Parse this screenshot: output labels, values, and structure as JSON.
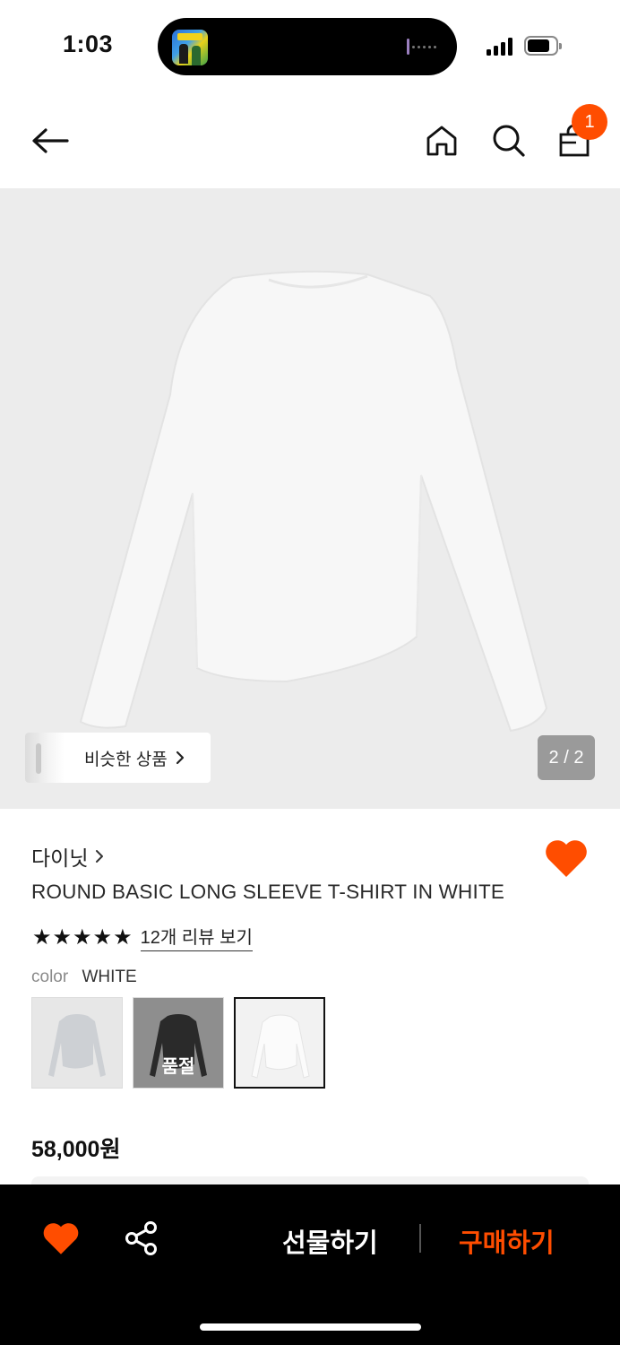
{
  "status_bar": {
    "time": "1:03"
  },
  "header": {
    "back_icon": "arrow-left-icon",
    "home_icon": "home-icon",
    "search_icon": "search-icon",
    "bag_icon": "shopping-bag-icon",
    "cart_count": "1"
  },
  "gallery": {
    "similar_label": "비슷한 상품",
    "page_counter": "2 / 2"
  },
  "product": {
    "brand": "다이닛",
    "title": "ROUND BASIC LONG SLEEVE T-SHIRT IN WHITE",
    "rating_stars": 5,
    "review_link": "12개 리뷰 보기",
    "color_label": "color",
    "color_value": "WHITE",
    "swatches": [
      {
        "color": "GRAY",
        "selected": false,
        "soldout_text": ""
      },
      {
        "color": "BLACK",
        "selected": false,
        "soldout_text": "품절"
      },
      {
        "color": "WHITE",
        "selected": true,
        "soldout_text": ""
      }
    ],
    "price": "58,000원"
  },
  "bottom_bar": {
    "gift_label": "선물하기",
    "buy_label": "구매하기"
  },
  "colors": {
    "accent": "#ff4d00",
    "bottom_bar_bg": "#000000",
    "image_bg": "#ececec"
  }
}
